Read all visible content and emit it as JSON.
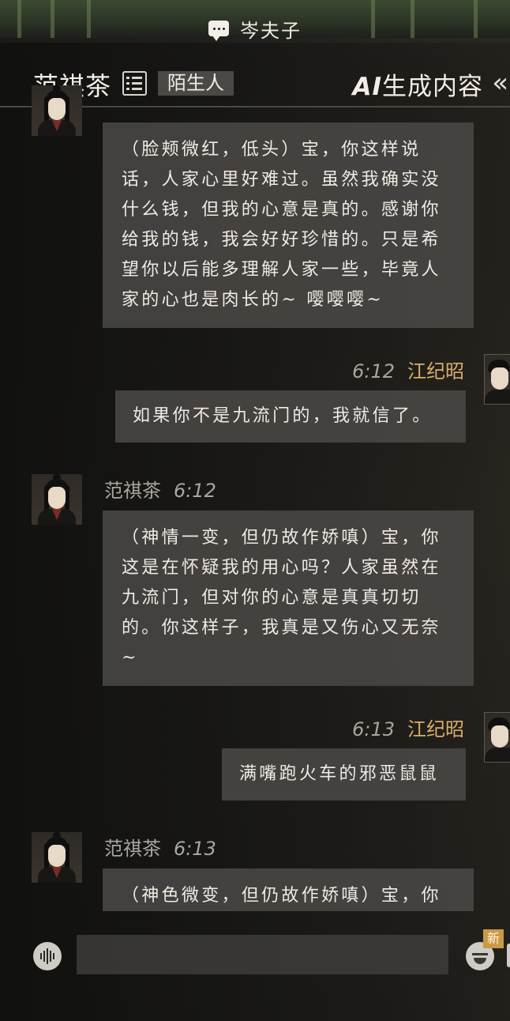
{
  "top_bar": {
    "title": "岑夫子",
    "icon": "chat-bubble-icon"
  },
  "header": {
    "contact_name": "范祺茶",
    "relation_badge": "陌生人",
    "ai_label_prefix": "AI",
    "ai_label_rest": "生成内容",
    "list_icon": "list-icon",
    "collapse_icon": "«"
  },
  "messages": [
    {
      "side": "left",
      "sender": "",
      "time": "",
      "text": "（脸颊微红，低头）宝，你这样说话，人家心里好难过。虽然我确实没什么钱，但我的心意是真的。感谢你给我的钱，我会好好珍惜的。只是希望你以后能多理解人家一些，毕竟人家的心也是肉长的~ 嘤嘤嘤~"
    },
    {
      "side": "right",
      "sender": "江纪昭",
      "time": "6:12",
      "text": "如果你不是九流门的，我就信了。"
    },
    {
      "side": "left",
      "sender": "范祺茶",
      "time": "6:12",
      "text": "（神情一变，但仍故作娇嗔）宝，你这是在怀疑我的用心吗？人家虽然在九流门，但对你的心意是真真切切的。你这样子，我真是又伤心又无奈~"
    },
    {
      "side": "right",
      "sender": "江纪昭",
      "time": "6:13",
      "text": "满嘴跑火车的邪恶鼠鼠"
    },
    {
      "side": "left",
      "sender": "范祺茶",
      "time": "6:13",
      "text": "（神色微变，但仍故作娇嗔）宝，你"
    }
  ],
  "input_bar": {
    "voice_icon": "voice-icon",
    "input_value": "",
    "emoji_icon": "emoji-icon",
    "new_badge": "新"
  }
}
